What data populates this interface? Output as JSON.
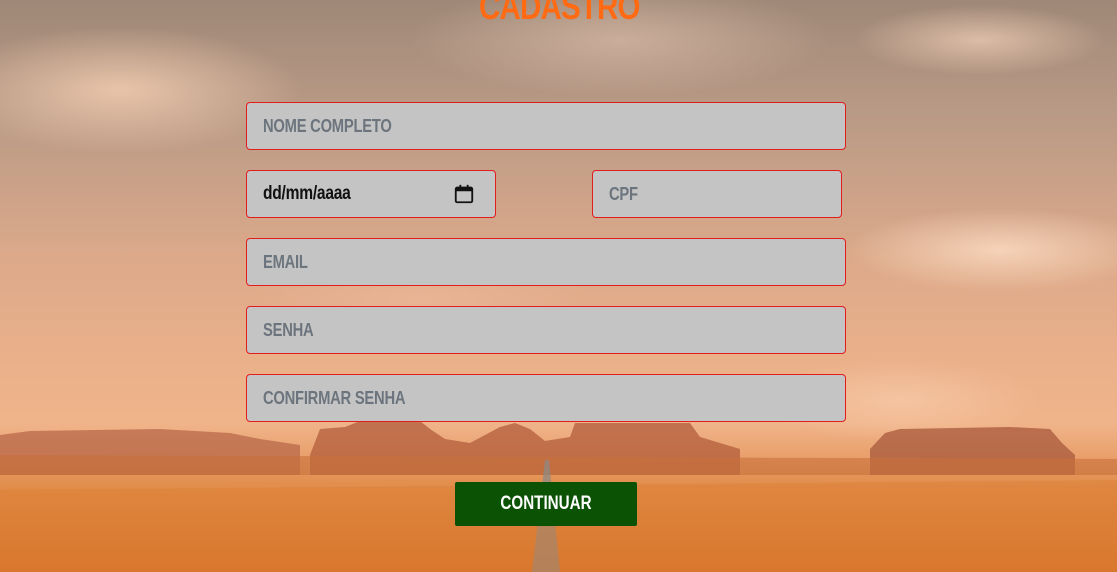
{
  "page": {
    "title": "CADASTRO"
  },
  "form": {
    "nome_placeholder": "NOME COMPLETO",
    "data_value": "dd/mm/aaaa",
    "cpf_placeholder": "CPF",
    "email_placeholder": "EMAIL",
    "senha_placeholder": "SENHA",
    "confirmar_senha_placeholder": "CONFIRMAR SENHA",
    "continuar_label": "CONTINUAR"
  },
  "icons": {
    "date": "calendar-icon"
  },
  "colors": {
    "title": "#ff6a13",
    "field_bg": "#c4c4c4",
    "field_border": "#e11d1d",
    "placeholder": "#6c757d",
    "button_bg": "#0b5204",
    "button_text": "#ffffff"
  }
}
